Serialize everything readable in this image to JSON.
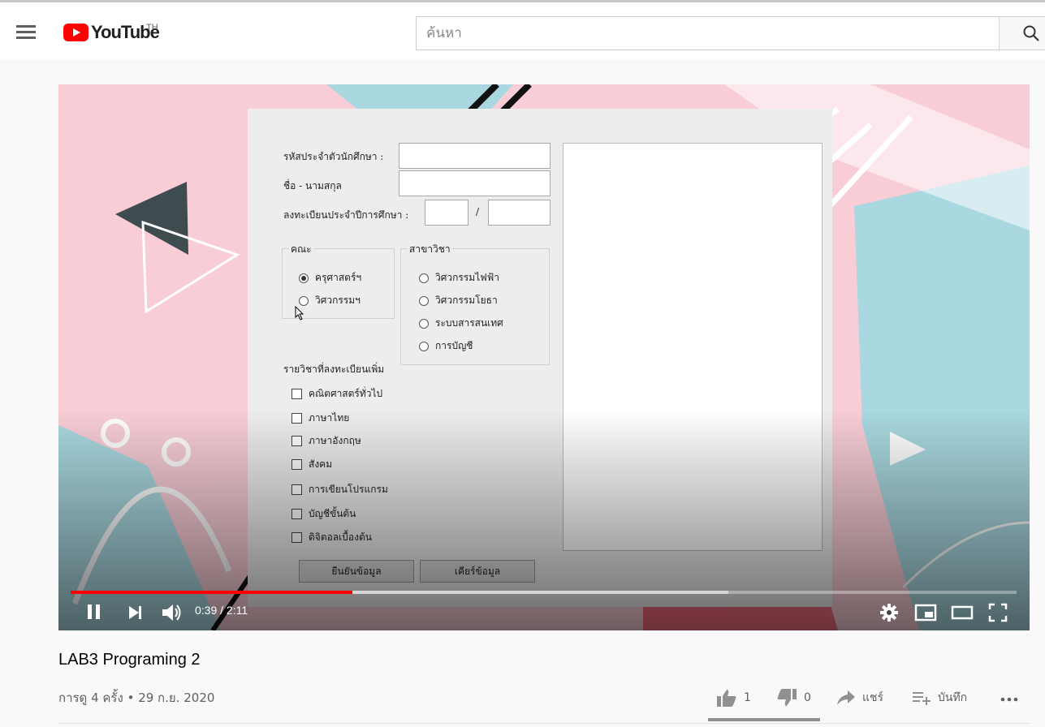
{
  "header": {
    "logo_text": "YouTube",
    "country_code": "TH",
    "search_placeholder": "ค้นหา"
  },
  "video_frame": {
    "form": {
      "student_id_label": "รหัสประจำตัวนักศึกษา :",
      "name_label": "ชื่อ - นามสกุล",
      "register_label": "ลงทะเบียนประจำปีการศึกษา :",
      "slash": "/",
      "faculty": {
        "title": "คณะ",
        "options": [
          {
            "label": "ครุศาสตร์ฯ",
            "selected": true
          },
          {
            "label": "วิศวกรรมฯ",
            "selected": false
          }
        ]
      },
      "major": {
        "title": "สาขาวิชา",
        "options": [
          {
            "label": "วิศวกรรมไฟฟ้า",
            "selected": false
          },
          {
            "label": "วิศวกรรมโยธา",
            "selected": false
          },
          {
            "label": "ระบบสารสนเทศ",
            "selected": false
          },
          {
            "label": "การบัญชี",
            "selected": false
          }
        ]
      },
      "courses_label": "รายวิชาที่ลงทะเบียนเพิ่ม",
      "courses": [
        "คณิตศาสตร์ทั่วไป",
        "ภาษาไทย",
        "ภาษาอังกฤษ",
        "สังคม",
        "การเขียนโปรแกรม",
        "บัญชีขั้นต้น",
        "ดิจิตอลเบื้องต้น"
      ],
      "confirm_button": "ยืนยันข้อมูล",
      "clear_button": "เคียร์ข้อมูล"
    }
  },
  "player": {
    "current_time": "0:39",
    "duration": "2:11",
    "time_separator": " / ",
    "played_fraction": 0.298,
    "loaded_fraction": 0.695
  },
  "video": {
    "title": "LAB3 Programing 2",
    "views": "การดู 4 ครั้ง",
    "separator": " • ",
    "date": "29 ก.ย. 2020"
  },
  "actions": {
    "likes": "1",
    "dislikes": "0",
    "share_label": "แชร์",
    "save_label": "บันทึก"
  }
}
